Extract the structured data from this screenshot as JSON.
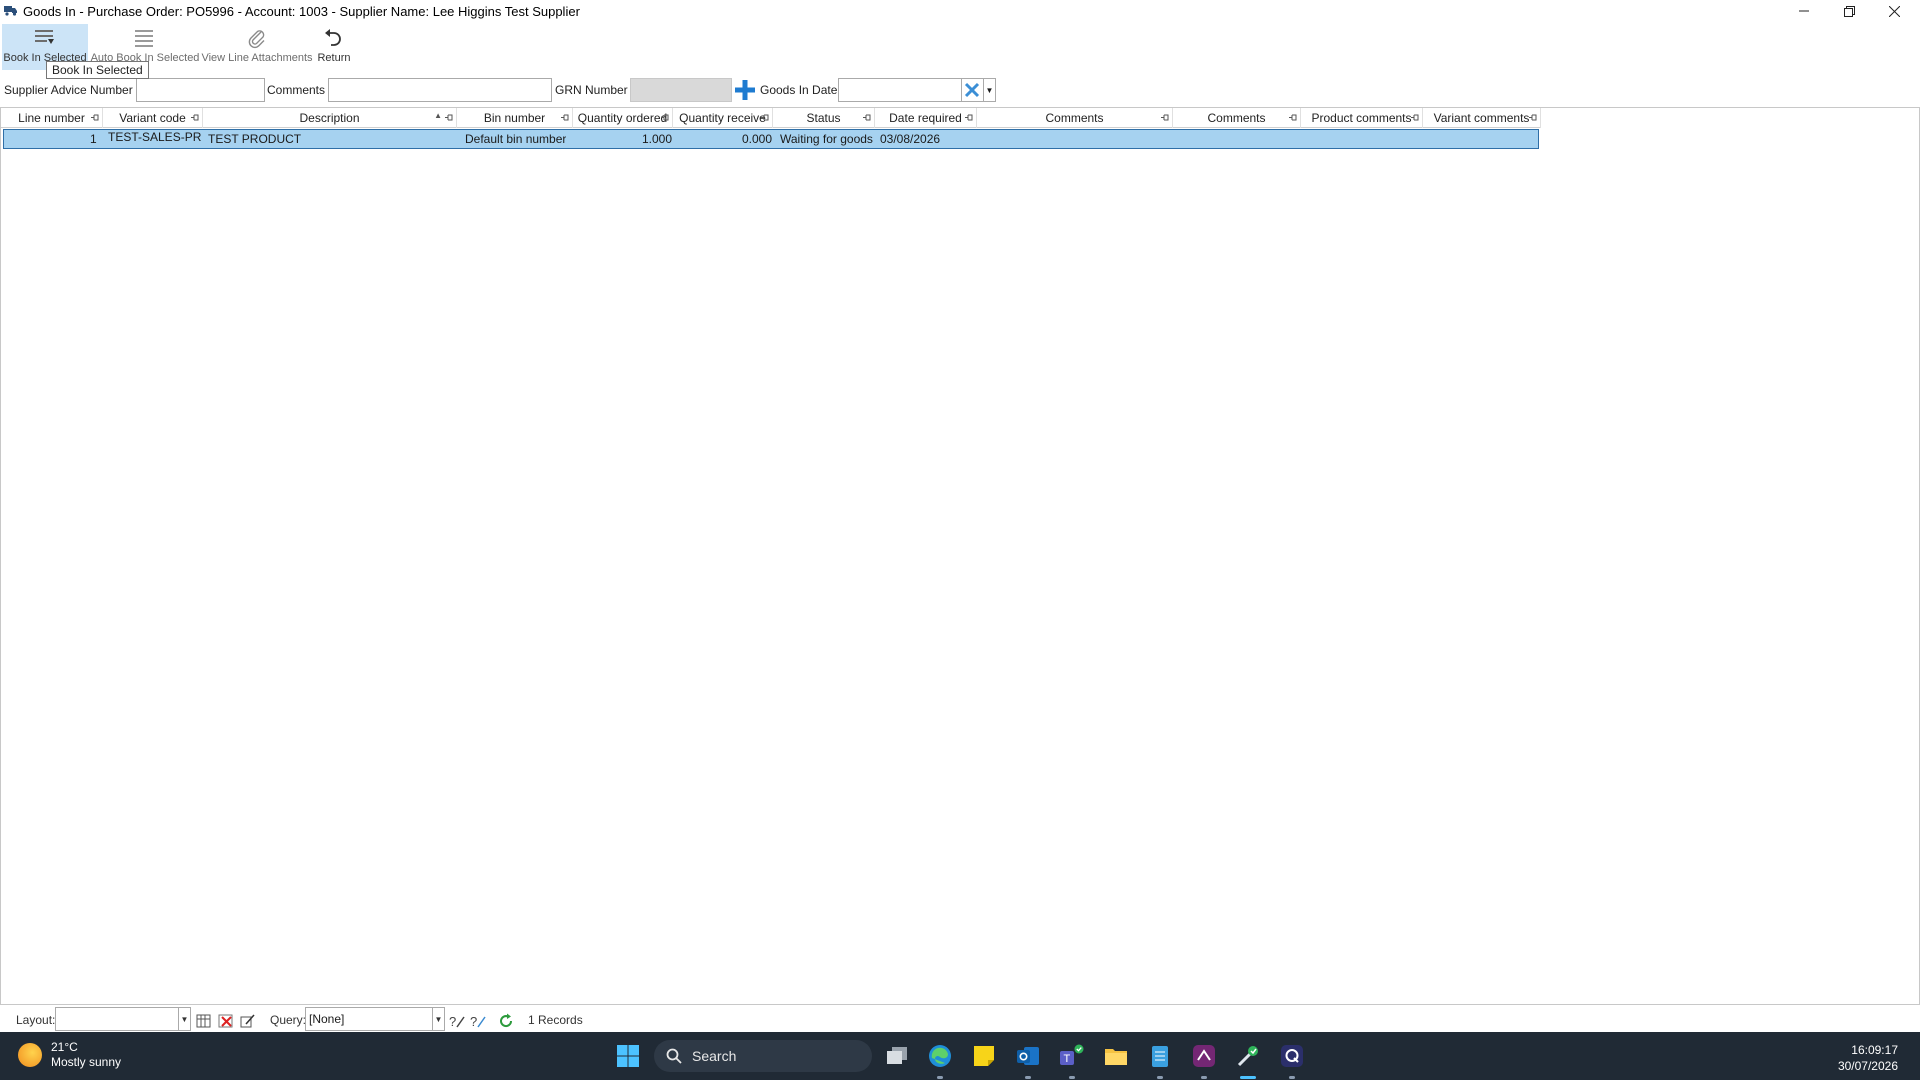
{
  "window": {
    "title": "Goods In - Purchase Order: PO5996 - Account: 1003 - Supplier Name: Lee Higgins Test Supplier"
  },
  "toolbar": {
    "book_in_selected": "Book In Selected",
    "auto_book_in_selected": "Auto Book In Selected",
    "view_line_attachments": "View Line Attachments",
    "return": "Return",
    "tooltip": "Book In Selected"
  },
  "fields": {
    "supplier_advice_label": "Supplier Advice Number",
    "supplier_advice_value": "",
    "comments_label": "Comments",
    "comments_value": "",
    "grn_label": "GRN Number",
    "grn_value": "",
    "goods_in_date_label": "Goods In Date",
    "goods_in_date_value": ""
  },
  "grid": {
    "columns": [
      "Line number",
      "Variant code",
      "Description",
      "Bin number",
      "Quantity ordered",
      "Quantity receive",
      "Status",
      "Date required",
      "Comments",
      "Comments",
      "Product comments",
      "Variant comments"
    ],
    "rows": [
      {
        "line_number": "1",
        "variant_code": "TEST-SALES-PR",
        "description": "TEST PRODUCT",
        "bin_number": "Default bin number",
        "quantity_ordered": "1.000",
        "quantity_received": "0.000",
        "status": "Waiting for goods",
        "date_required": "03/08/2026",
        "comments1": "",
        "comments2": "",
        "product_comments": "",
        "variant_comments": ""
      }
    ]
  },
  "footer": {
    "layout_label": "Layout:",
    "layout_value": "",
    "query_label": "Query:",
    "query_value": "[None]",
    "records": "1 Records"
  },
  "taskbar": {
    "weather_temp": "21°C",
    "weather_desc": "Mostly sunny",
    "search_label": "Search",
    "time": "16:09:17",
    "date": "30/07/2026"
  }
}
